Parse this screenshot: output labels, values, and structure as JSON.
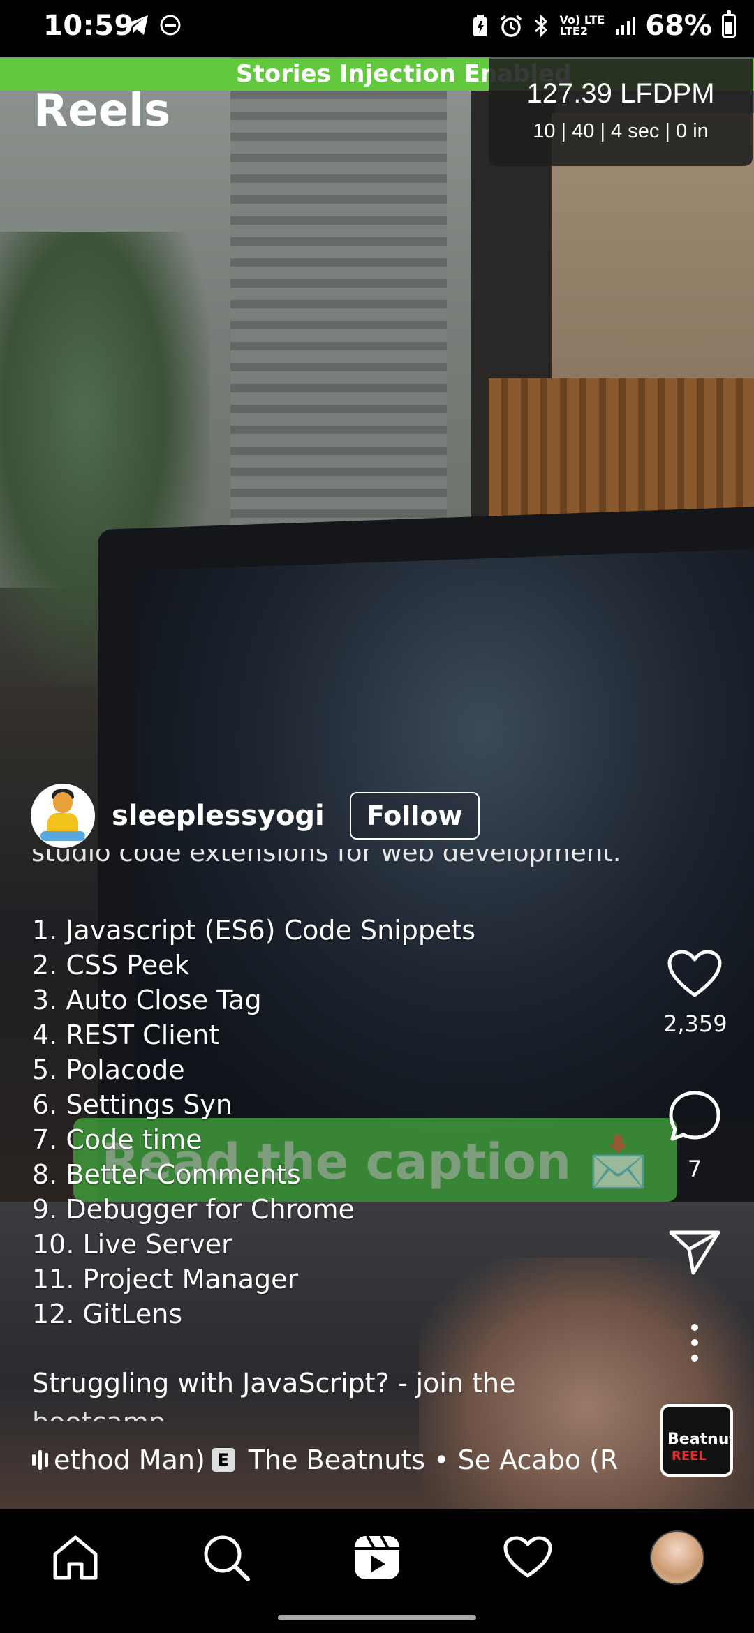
{
  "status_bar": {
    "time": "10:59",
    "network": "Vo) LTE\nLTE2",
    "battery": "68%"
  },
  "header": {
    "injection_banner": "Stories Injection Enabled",
    "title": "Reels",
    "perf_main": "127.39 LFDPM",
    "perf_sub": "10 | 40 | 4 sec | 0 in"
  },
  "video": {
    "overlay_text": "Read the caption 📩"
  },
  "author": {
    "username": "sleeplessyogi",
    "follow_label": "Follow"
  },
  "caption": {
    "partial_line": "studio code extensions for web development.",
    "items": [
      "1. Javascript (ES6) Code Snippets",
      "2. CSS Peek",
      "3. Auto Close Tag",
      "4. REST Client",
      "5. Polacode",
      "6. Settings Syn",
      "7. Code time",
      "8. Better Comments",
      "9. Debugger for Chrome",
      "10. Live Server",
      "11. Project Manager",
      "12. GitLens"
    ],
    "cta": "Struggling with JavaScript? - join the",
    "cta_cut": "bootcamp"
  },
  "actions": {
    "likes": "2,359",
    "comments": "7"
  },
  "music": {
    "artist_fragment": "ethod Man)",
    "explicit_badge": "E",
    "track": "The Beatnuts • Se Acabo (R",
    "album_text_1": "Beatnuts",
    "album_text_2": "REEL"
  },
  "colors": {
    "injection_green": "#62c83d",
    "banner_green": "#3f9a3a"
  },
  "icons": [
    "home-icon",
    "search-icon",
    "reels-icon",
    "heart-icon",
    "comment-icon",
    "send-icon",
    "more-icon"
  ]
}
